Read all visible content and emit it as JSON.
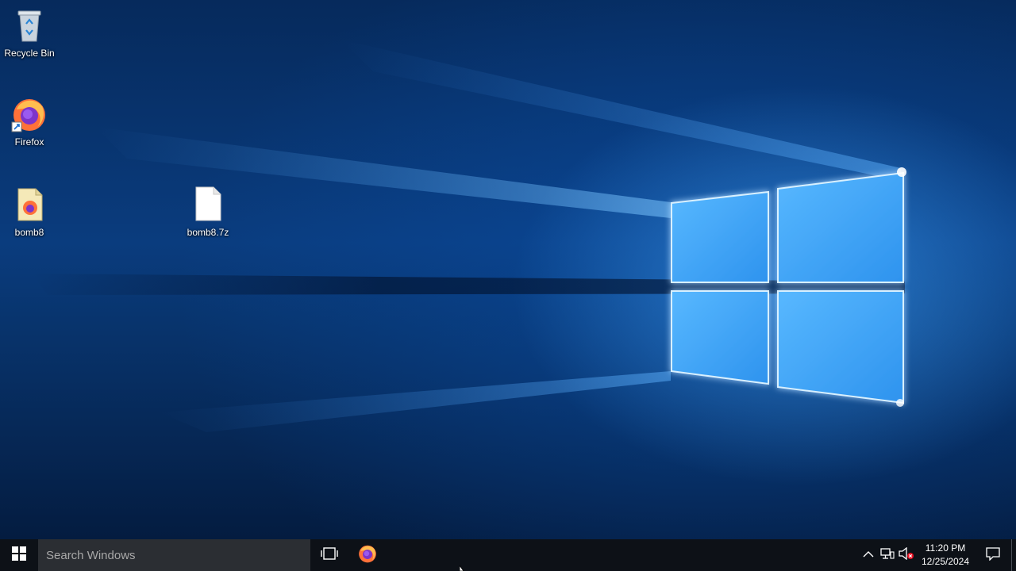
{
  "desktop": {
    "icons": [
      {
        "label": "Recycle Bin",
        "icon": "recycle-bin-icon"
      },
      {
        "label": "Firefox",
        "icon": "firefox-icon"
      },
      {
        "label": "bomb8",
        "icon": "html-file-icon"
      },
      {
        "label": "bomb8.7z",
        "icon": "blank-file-icon"
      }
    ]
  },
  "taskbar": {
    "start_icon": "windows-logo-icon",
    "search_placeholder": "Search Windows",
    "task_view_icon": "task-view-icon",
    "pinned": [
      {
        "name": "Firefox",
        "icon": "firefox-icon"
      }
    ],
    "tray": {
      "icons": [
        "chevron-up-icon",
        "network-icon",
        "volume-muted-icon"
      ],
      "time": "11:20 PM",
      "date": "12/25/2024",
      "action_center_icon": "notification-icon"
    }
  },
  "colors": {
    "wallpaper_blue": "#0a3c7e",
    "taskbar_bg": "#0d1117",
    "search_bg": "#2b2e33"
  }
}
